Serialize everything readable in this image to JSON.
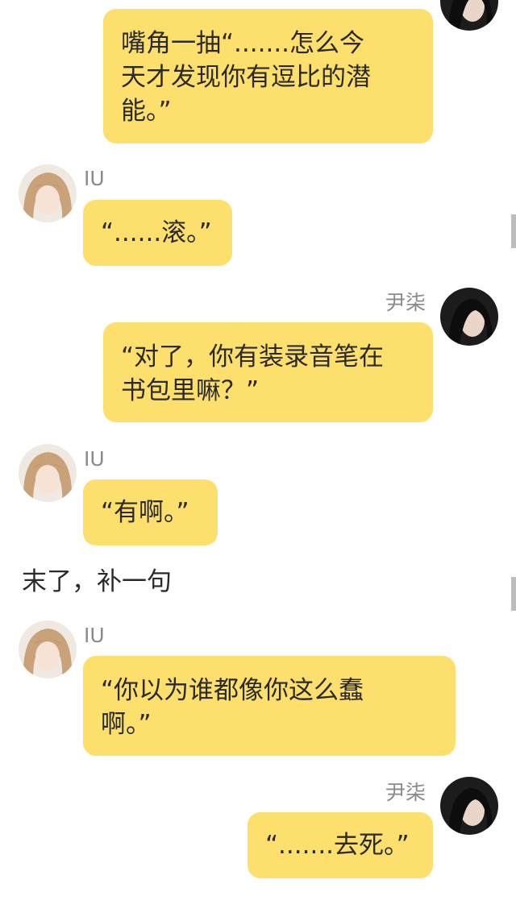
{
  "participants": {
    "self": {
      "name": "尹柒",
      "avatar_icon": "dark-hair-avatar-icon"
    },
    "other": {
      "name": "IU",
      "avatar_icon": "light-hair-avatar-icon"
    }
  },
  "colors": {
    "bubble": "#fddf6e",
    "name": "#8a8a8a",
    "text": "#2a2a2a",
    "background": "#ffffff"
  },
  "messages": [
    {
      "sender": "尹柒",
      "text": "嘴角一抽“.......怎么今\n天才发现你有逗比的潜\n能。”"
    },
    {
      "sender": "IU",
      "text": "“......滚。”"
    },
    {
      "sender": "尹柒",
      "text": "“对了，你有装录音笔在\n书包里嘛？”"
    },
    {
      "sender": "IU",
      "text": "“有啊。”"
    },
    {
      "narration": "末了，补一句"
    },
    {
      "sender": "IU",
      "text": "“你以为谁都像你这么蠢\n啊。”"
    },
    {
      "sender": "尹柒",
      "text": "“.......去死。”"
    }
  ]
}
